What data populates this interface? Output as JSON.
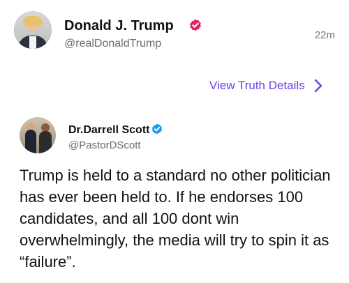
{
  "post": {
    "author_name": "Donald J. Trump",
    "author_handle": "@realDonaldTrump",
    "time": "22m",
    "verified_icon": "verified-badge-icon",
    "badge_color": "#e0245e"
  },
  "actions": {
    "view_details_label": "View Truth Details",
    "accent_color": "#6b3fe1"
  },
  "quoted": {
    "author_name": "Dr.Darrell Scott",
    "author_handle": "@PastorDScott",
    "verified_icon": "verified-badge-icon",
    "badge_color": "#1d9bf0",
    "text": "Trump is held to a standard no other politician has ever been held to. If he endorses 100 candidates, and all 100 dont win overwhelmingly, the media will try to spin it as “failure”."
  }
}
